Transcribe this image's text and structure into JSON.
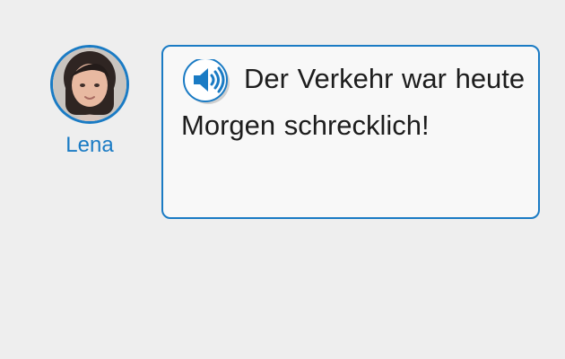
{
  "speaker": {
    "name": "Lena",
    "avatar_icon": "avatar-photo"
  },
  "message": {
    "text": "Der Verkehr war heute Morgen schrecklich!",
    "audio_icon": "speaker-volume-icon"
  },
  "colors": {
    "accent": "#1a7bc4",
    "background": "#eeeeee",
    "bubble": "#f8f8f8",
    "text": "#1d1d1d"
  }
}
